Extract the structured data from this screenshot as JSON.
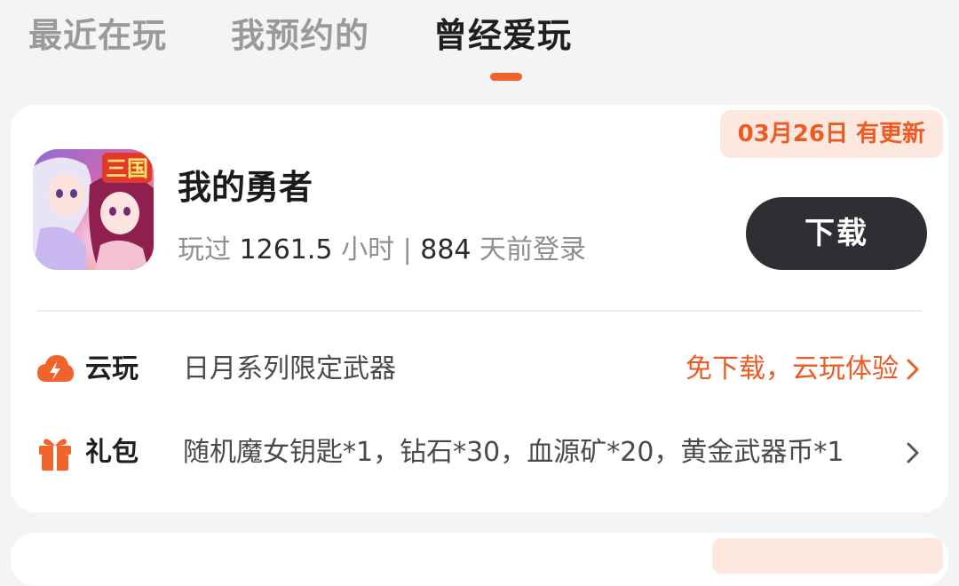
{
  "tabs": [
    {
      "label": "最近在玩",
      "active": false
    },
    {
      "label": "我预约的",
      "active": false
    },
    {
      "label": "曾经爱玩",
      "active": true
    }
  ],
  "card": {
    "update_badge": "03月26日 有更新",
    "game": {
      "icon": "game-cover-art",
      "icon_text": "三国",
      "title": "我的勇者",
      "stats_prefix": "玩过 ",
      "hours": "1261.5",
      "hours_unit": " 小时 | ",
      "days": "884",
      "days_unit": " 天前登录"
    },
    "download_label": "下载",
    "cloud": {
      "icon": "cloud-lightning-icon",
      "label": "云玩",
      "text": "日月系列限定武器",
      "action": "免下载，云玩体验"
    },
    "gift": {
      "icon": "gift-icon",
      "label": "礼包",
      "text": "随机魔女钥匙*1，钻石*30，血源矿*20，黄金武器币*1"
    }
  },
  "colors": {
    "accent": "#ee5a24",
    "button_bg": "#2d2f33",
    "badge_bg": "#fde8df"
  }
}
